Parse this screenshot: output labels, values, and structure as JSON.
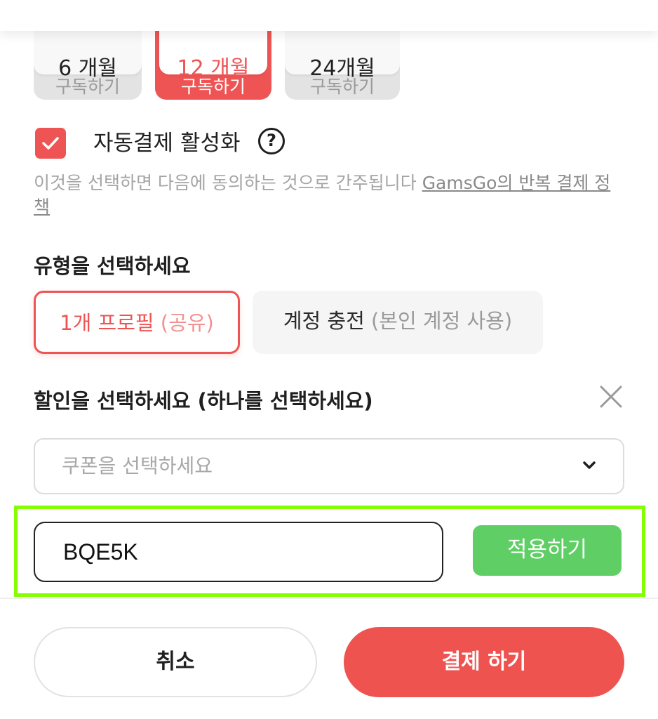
{
  "plans": [
    {
      "label": "6 개월",
      "sub": "구독하기",
      "selected": false
    },
    {
      "label": "12 개월",
      "sub": "구독하기",
      "selected": true
    },
    {
      "label": "24개월",
      "sub": "구독하기",
      "selected": false
    }
  ],
  "autopay": {
    "checked": true,
    "label": "자동결제 활성화",
    "help_icon": "?",
    "notice": "이것을 선택하면 다음에 동의하는 것으로 간주됩니다 ",
    "policy_link": "GamsGo의 반복 결제 정책"
  },
  "type_section": {
    "title": "유형을 선택하세요",
    "options": [
      {
        "main": "1개 프로필 ",
        "dim": "(공유)",
        "selected": true
      },
      {
        "main": "계정 충전 ",
        "dim": "(본인 계정 사용)",
        "selected": false
      }
    ]
  },
  "discount_section": {
    "title": "할인을 선택하세요 (하나를 선택하세요)",
    "coupon_placeholder": "쿠폰을 선택하세요",
    "code_value": "BQE5K",
    "apply_label": "적용하기"
  },
  "actions": {
    "cancel_label": "취소",
    "pay_label": "결제 하기"
  },
  "colors": {
    "accent": "#ee5454",
    "apply_green": "#5fce65",
    "highlight": "#84ff00"
  },
  "icons": {
    "checkbox": "check-icon",
    "help": "question-circle-icon",
    "close": "close-icon",
    "dropdown": "chevron-down-icon"
  }
}
